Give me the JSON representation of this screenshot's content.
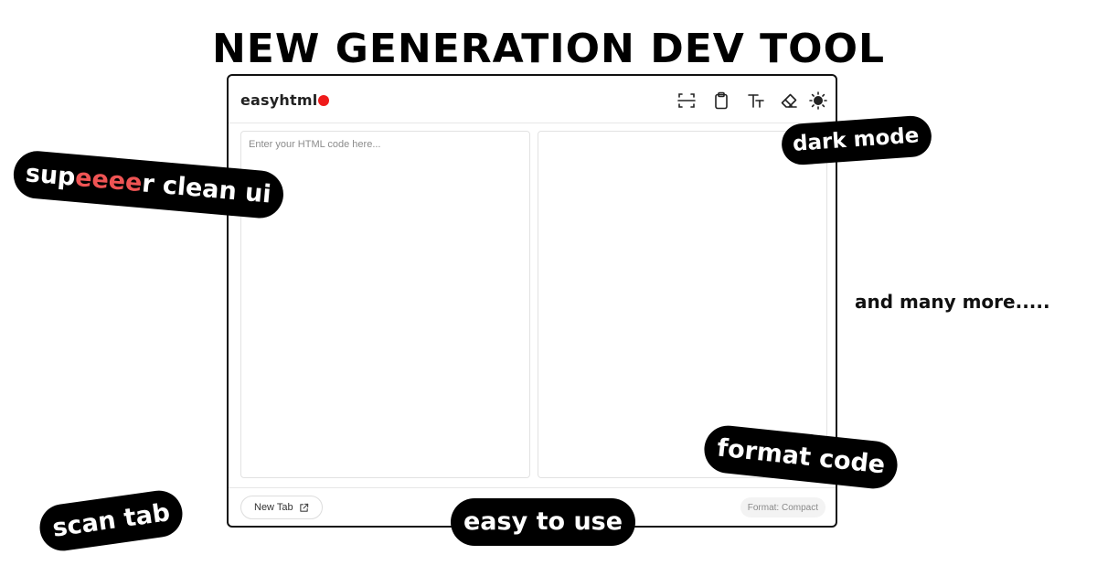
{
  "headline": "NEW GENERATION DEV TOOL",
  "app": {
    "logo": "easyhtml",
    "logo_dot_color": "#ef1b1b"
  },
  "toolbar": {
    "icons": [
      "scan-icon",
      "clipboard-icon",
      "text-size-icon",
      "eraser-icon",
      "sun-icon"
    ]
  },
  "editor": {
    "value": "",
    "placeholder": "Enter your HTML code here..."
  },
  "preview": {
    "content": ""
  },
  "footer": {
    "new_tab_label": "New Tab",
    "new_tab_icon": "external-link-icon",
    "format_label": "Format: Compact"
  },
  "callouts": {
    "dark_mode": "dark mode",
    "clean_ui_prefix": "sup",
    "clean_ui_accent": "eeee",
    "clean_ui_suffix": "r clean ui",
    "format_code": "format code",
    "scan_tab": "scan tab",
    "easy_to_use": "easy to use",
    "many_more": "and many more.....",
    "accent_color": "#ef5454"
  }
}
